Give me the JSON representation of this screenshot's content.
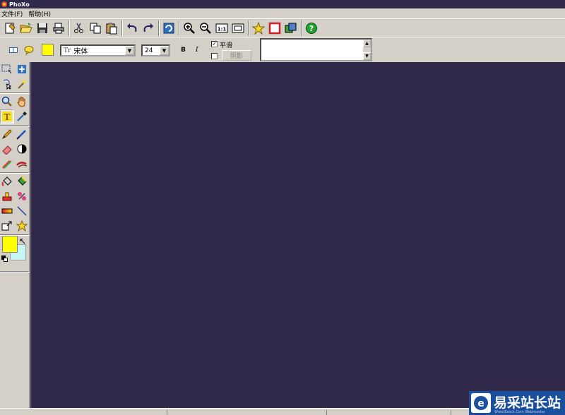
{
  "window": {
    "title": "PhoXo"
  },
  "menu": [
    {
      "label": "文件(F)"
    },
    {
      "label": "帮助(H)"
    }
  ],
  "toolbar": {
    "buttons": [
      {
        "icon": "new-file-icon"
      },
      {
        "icon": "open-folder-icon"
      },
      {
        "icon": "save-icon"
      },
      {
        "icon": "print-icon"
      },
      {
        "icon": "cut-icon"
      },
      {
        "icon": "copy-icon"
      },
      {
        "icon": "paste-icon"
      },
      {
        "icon": "undo-icon"
      },
      {
        "icon": "redo-icon"
      },
      {
        "icon": "refresh-icon"
      },
      {
        "icon": "zoom-in-icon"
      },
      {
        "icon": "zoom-out-icon"
      },
      {
        "icon": "actual-size-icon"
      },
      {
        "icon": "fit-window-icon"
      },
      {
        "icon": "star-effect-icon"
      },
      {
        "icon": "frame-icon"
      },
      {
        "icon": "layers-icon"
      },
      {
        "icon": "help-icon"
      }
    ]
  },
  "text_options": {
    "font_name": "宋体",
    "font_size": "24",
    "bold_label": "B",
    "italic_label": "I",
    "smooth_label": "平滑",
    "smooth_checked": true,
    "shadow_checked": false,
    "shadow_button_label": "阴影",
    "text_value": "",
    "text_color": "#ffff00"
  },
  "colors": {
    "foreground": "#ffff00",
    "background": "#c8f6f6",
    "canvas": "#312a4a"
  },
  "watermark": {
    "title": "易采站长站",
    "url": "Www.Easck.Com  Webmaster"
  }
}
